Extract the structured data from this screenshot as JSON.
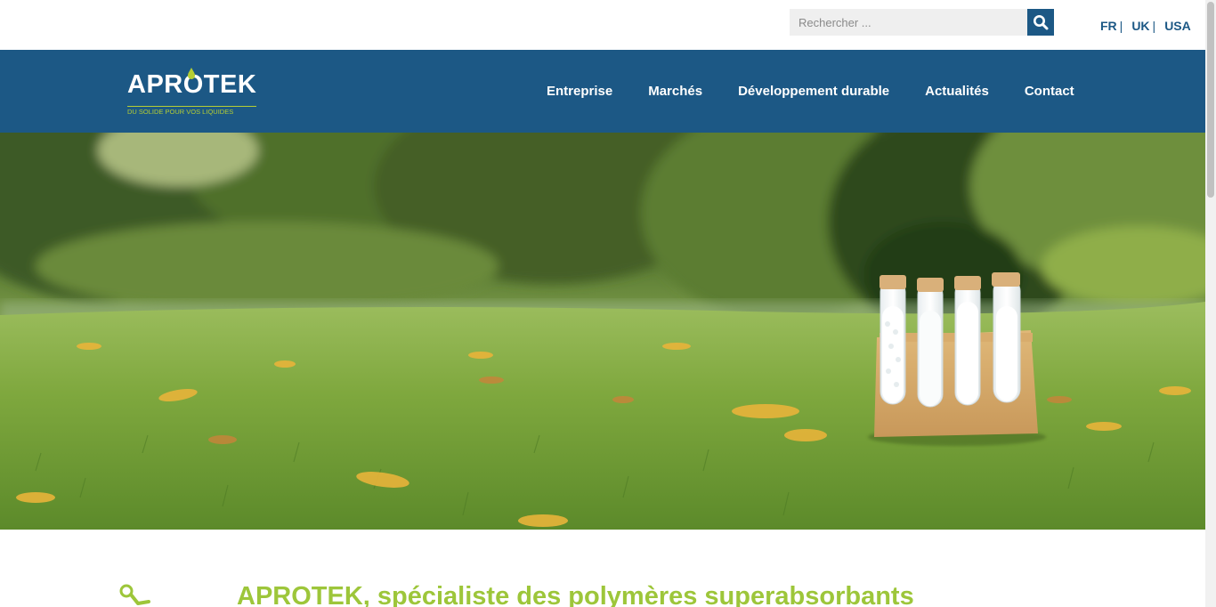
{
  "header": {
    "search": {
      "placeholder": "Rechercher ..."
    },
    "languages": [
      {
        "label": "FR"
      },
      {
        "label": "UK"
      },
      {
        "label": "USA"
      }
    ],
    "separator": "|"
  },
  "brand": {
    "name": "APROTEK",
    "tagline": "DU SOLIDE POUR VOS LIQUIDES",
    "colors": {
      "primary": "#1c5885",
      "accent": "#b5ce34",
      "heading": "#9dc63a"
    }
  },
  "nav": {
    "items": [
      {
        "label": "Entreprise"
      },
      {
        "label": "Marchés"
      },
      {
        "label": "Développement durable"
      },
      {
        "label": "Actualités"
      },
      {
        "label": "Contact"
      }
    ]
  },
  "hero": {
    "icon": "test-tubes-photo"
  },
  "intro": {
    "icon": "molecule-icon",
    "heading": "APROTEK, spécialiste des polymères superabsorbants"
  }
}
